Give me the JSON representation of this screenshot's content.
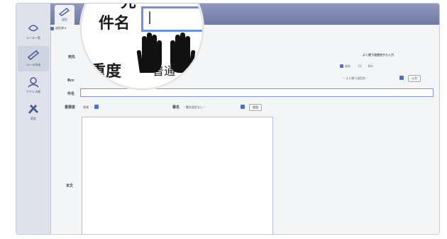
{
  "sidebar": {
    "items": [
      {
        "label": "メール一覧",
        "icon": "mail-list-icon"
      },
      {
        "label": "メール作成",
        "icon": "mail-compose-icon"
      },
      {
        "label": "アドレス帳",
        "icon": "address-book-icon"
      },
      {
        "label": "設定",
        "icon": "settings-icon"
      }
    ]
  },
  "header": {
    "tab_label": "送信"
  },
  "note": "送信済メ",
  "form": {
    "to_label": "宛先",
    "bcc_label": "Bcc",
    "subject_label": "件名",
    "importance_label": "重要度",
    "importance_value": "普通",
    "signature_label": "署名",
    "signature_value": "--署名設定なし--",
    "signature_button": "追加",
    "body_label": "本文",
    "frequent_title": "よく使う送信先から入力",
    "frequent_options": [
      "宛先",
      "Cc",
      "Bcc"
    ],
    "frequent_select": "-- よく使う送信先 --",
    "frequent_button": "入力"
  },
  "lens": {
    "top_fragment": "先",
    "subject_label": "件名",
    "cursor": "|",
    "importance_fragment": "重度",
    "importance_value": "普通"
  },
  "colors": {
    "accent": "#4a6fd0",
    "header": "#7a84b0"
  }
}
